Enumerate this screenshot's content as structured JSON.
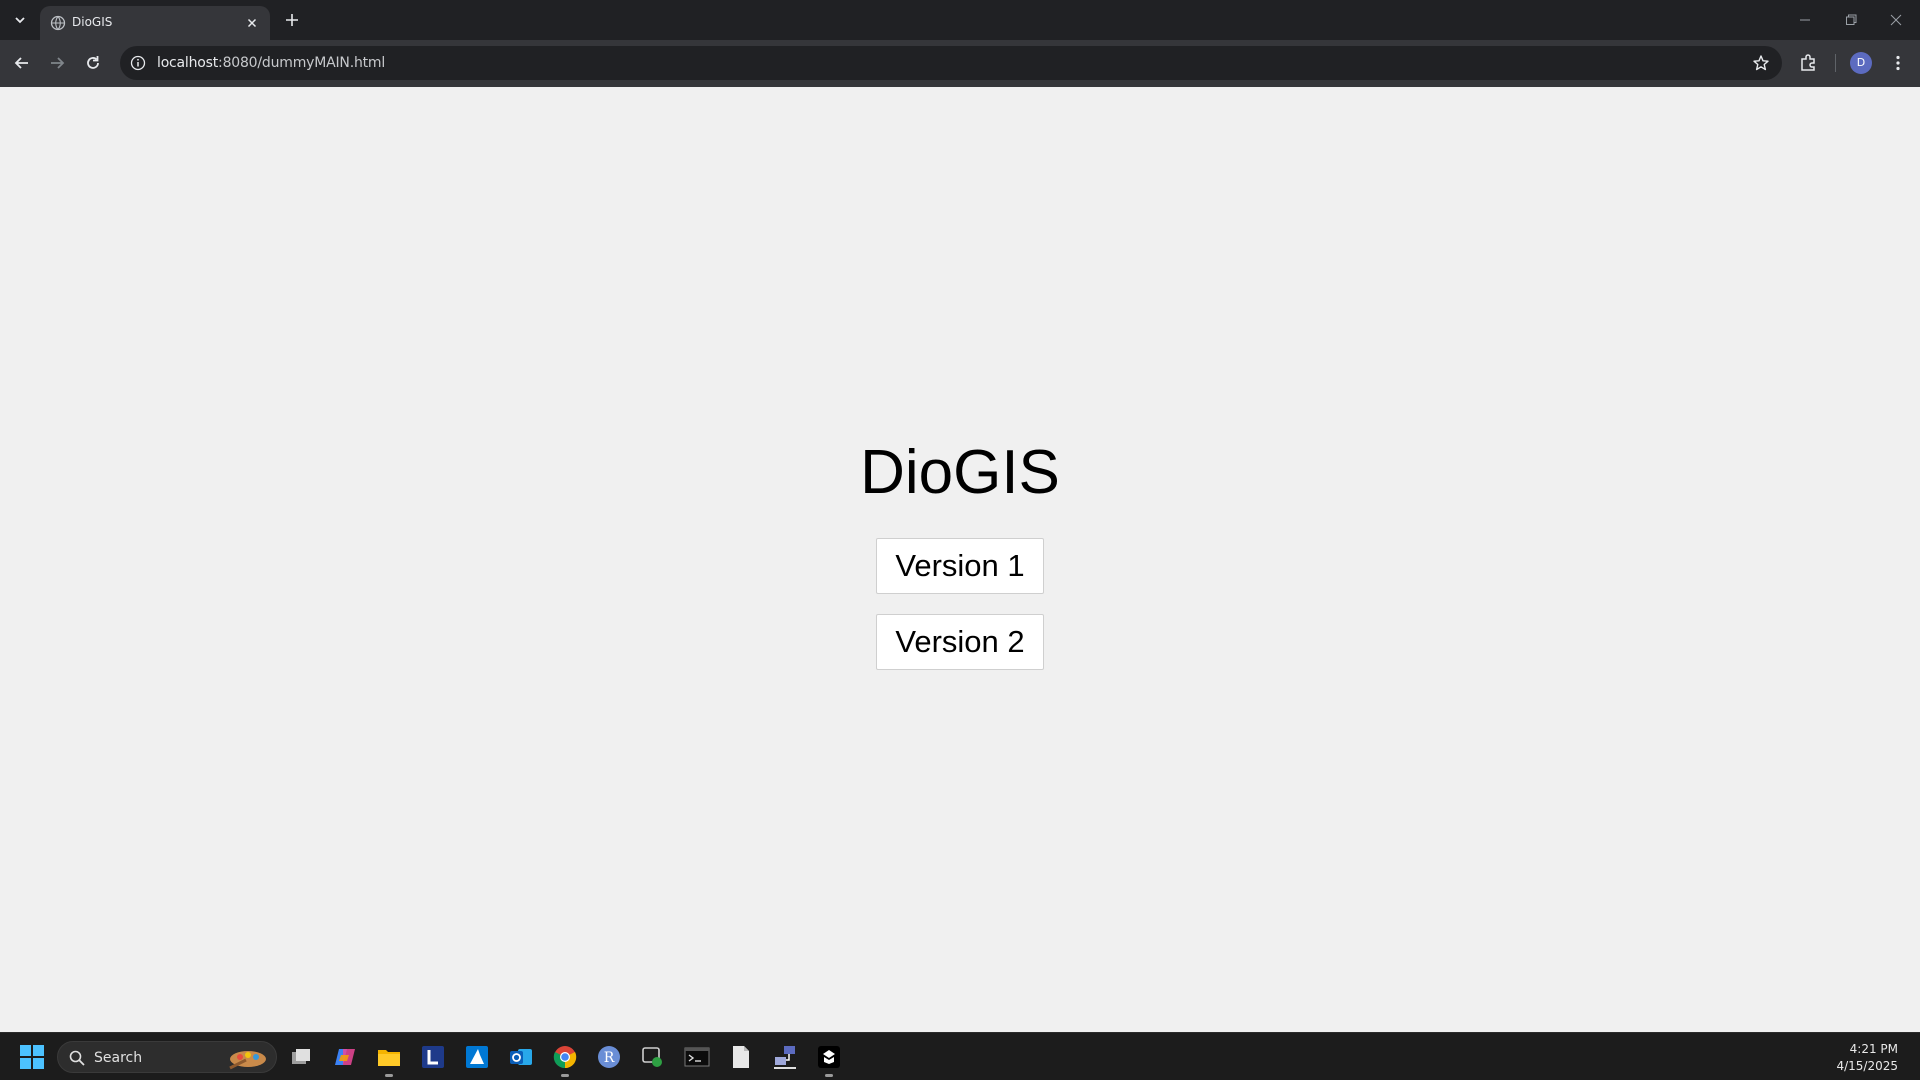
{
  "browser": {
    "tab": {
      "title": "DioGIS",
      "favicon": "globe-icon"
    },
    "address": {
      "host": "localhost",
      "path": ":8080/dummyMAIN.html"
    },
    "profile_initial": "D"
  },
  "page": {
    "title": "DioGIS",
    "buttons": [
      {
        "label": "Version 1"
      },
      {
        "label": "Version 2"
      }
    ]
  },
  "taskbar": {
    "search_placeholder": "Search",
    "apps": [
      "windows-start-icon",
      "task-view-icon",
      "copilot-icon",
      "file-explorer-icon",
      "l-app-icon",
      "azure-icon",
      "outlook-icon",
      "chrome-icon",
      "r-icon",
      "rstudio-icon",
      "terminal-icon",
      "notepad-icon",
      "network-icon",
      "inkscape-icon"
    ],
    "time": "4:21 PM",
    "date": "4/15/2025"
  },
  "colors": {
    "page_bg": "#f0f0f0",
    "chrome_dark": "#202124",
    "chrome_toolbar": "#35363a",
    "avatar": "#5c6bc0"
  }
}
